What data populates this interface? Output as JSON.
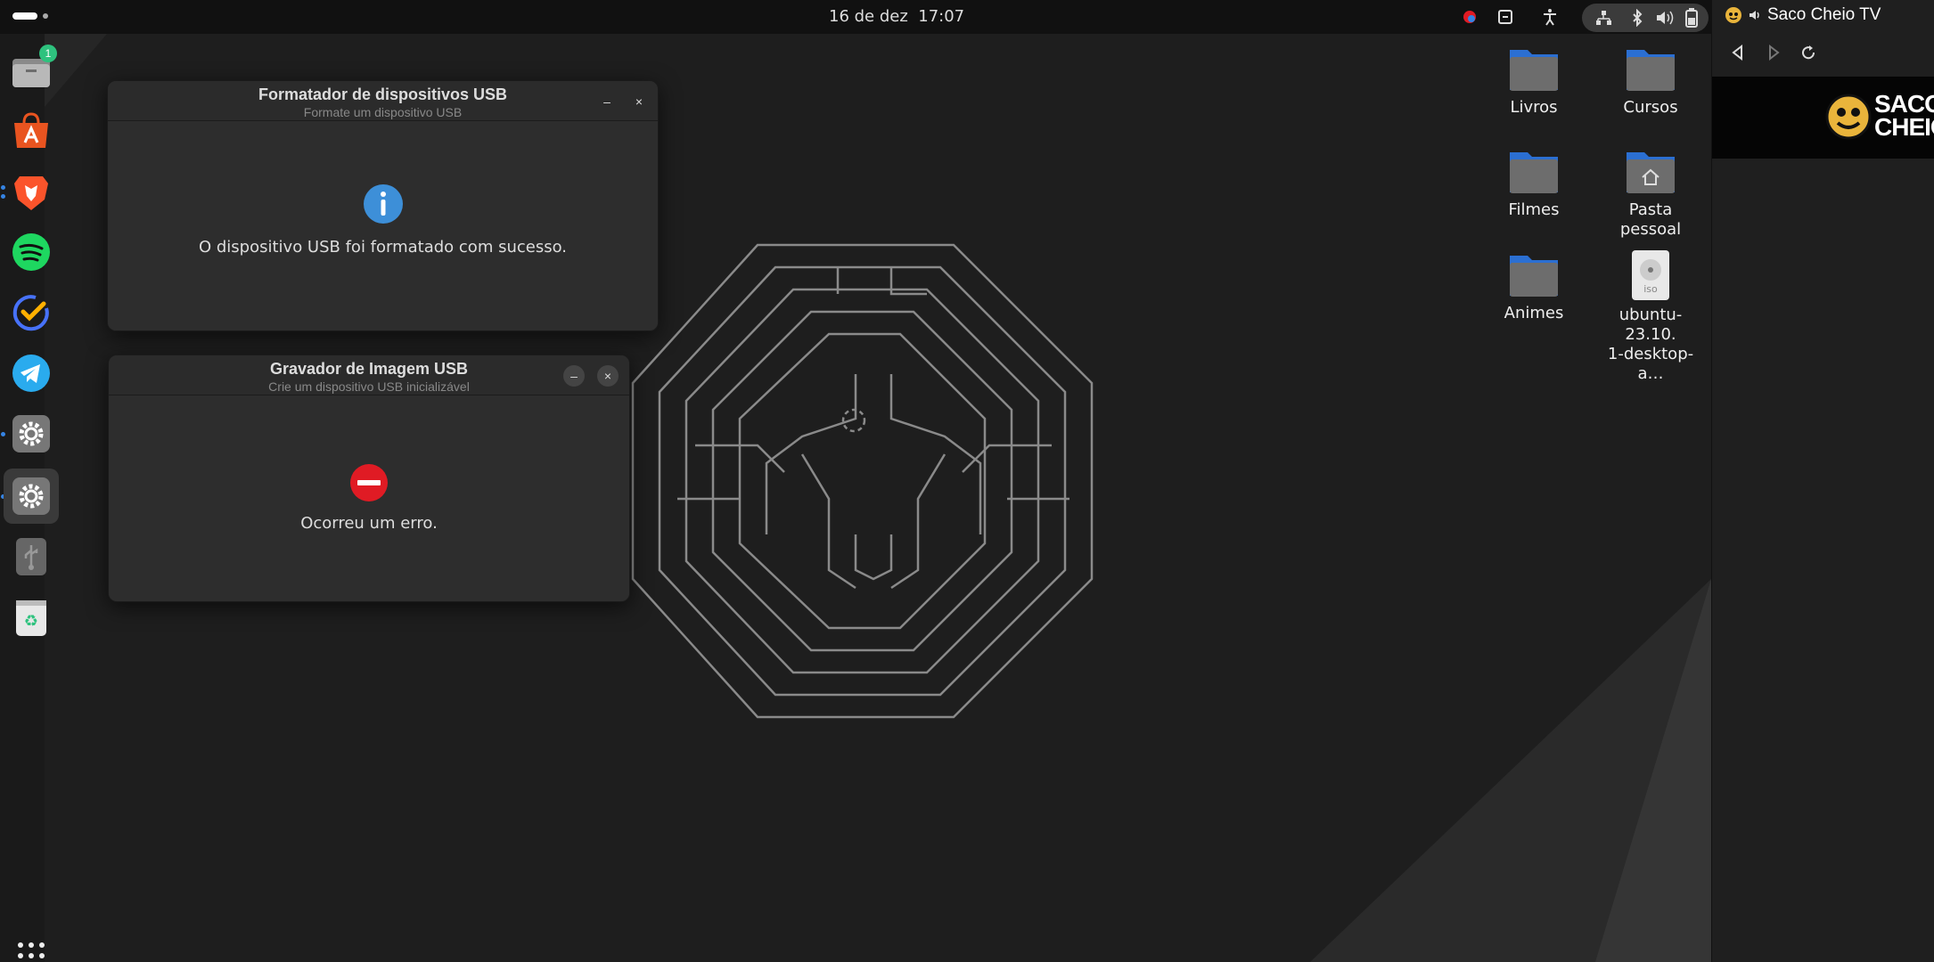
{
  "topbar": {
    "date": "16 de dez",
    "time": "17:07"
  },
  "dock": {
    "files_badge": "1",
    "items": [
      {
        "icon": "files-icon"
      },
      {
        "icon": "app-center-icon"
      },
      {
        "icon": "brave-browser-icon"
      },
      {
        "icon": "spotify-icon"
      },
      {
        "icon": "tasks-icon"
      },
      {
        "icon": "telegram-icon"
      },
      {
        "icon": "settings-icon"
      },
      {
        "icon": "settings-icon"
      },
      {
        "icon": "usb-icon"
      },
      {
        "icon": "trash-icon"
      },
      {
        "icon": "app-grid-icon"
      }
    ]
  },
  "desktop": {
    "icons": [
      {
        "label": "Livros"
      },
      {
        "label": "Cursos"
      },
      {
        "label": "Filmes"
      },
      {
        "label": "Pasta pessoal"
      },
      {
        "label": "Animes"
      },
      {
        "label": "ubuntu-23.10.1-desktop-a…",
        "line1": "ubuntu-23.10.",
        "line2": "1-desktop-a…",
        "badge": "iso"
      }
    ]
  },
  "windows": {
    "formatter": {
      "title": "Formatador de dispositivos USB",
      "subtitle": "Formate um dispositivo USB",
      "message": "O dispositivo USB foi formatado com sucesso.",
      "minimize_label": "–",
      "close_label": "×"
    },
    "writer": {
      "title": "Gravador de Imagem USB",
      "subtitle": "Crie um dispositivo USB inicializável",
      "message": "Ocorreu um erro.",
      "minimize_label": "–",
      "close_label": "×"
    }
  },
  "browser": {
    "title": "Saco Cheio TV",
    "banner_text_1": "SACO",
    "banner_text_2": "CHEIO"
  },
  "colors": {
    "accent": "#3584e4",
    "info": "#3d8fd8",
    "error": "#e01b24",
    "folder": "#6d6d6d",
    "folder_tab": "#2b6fd2",
    "banner_gold": "#e9b43b"
  }
}
